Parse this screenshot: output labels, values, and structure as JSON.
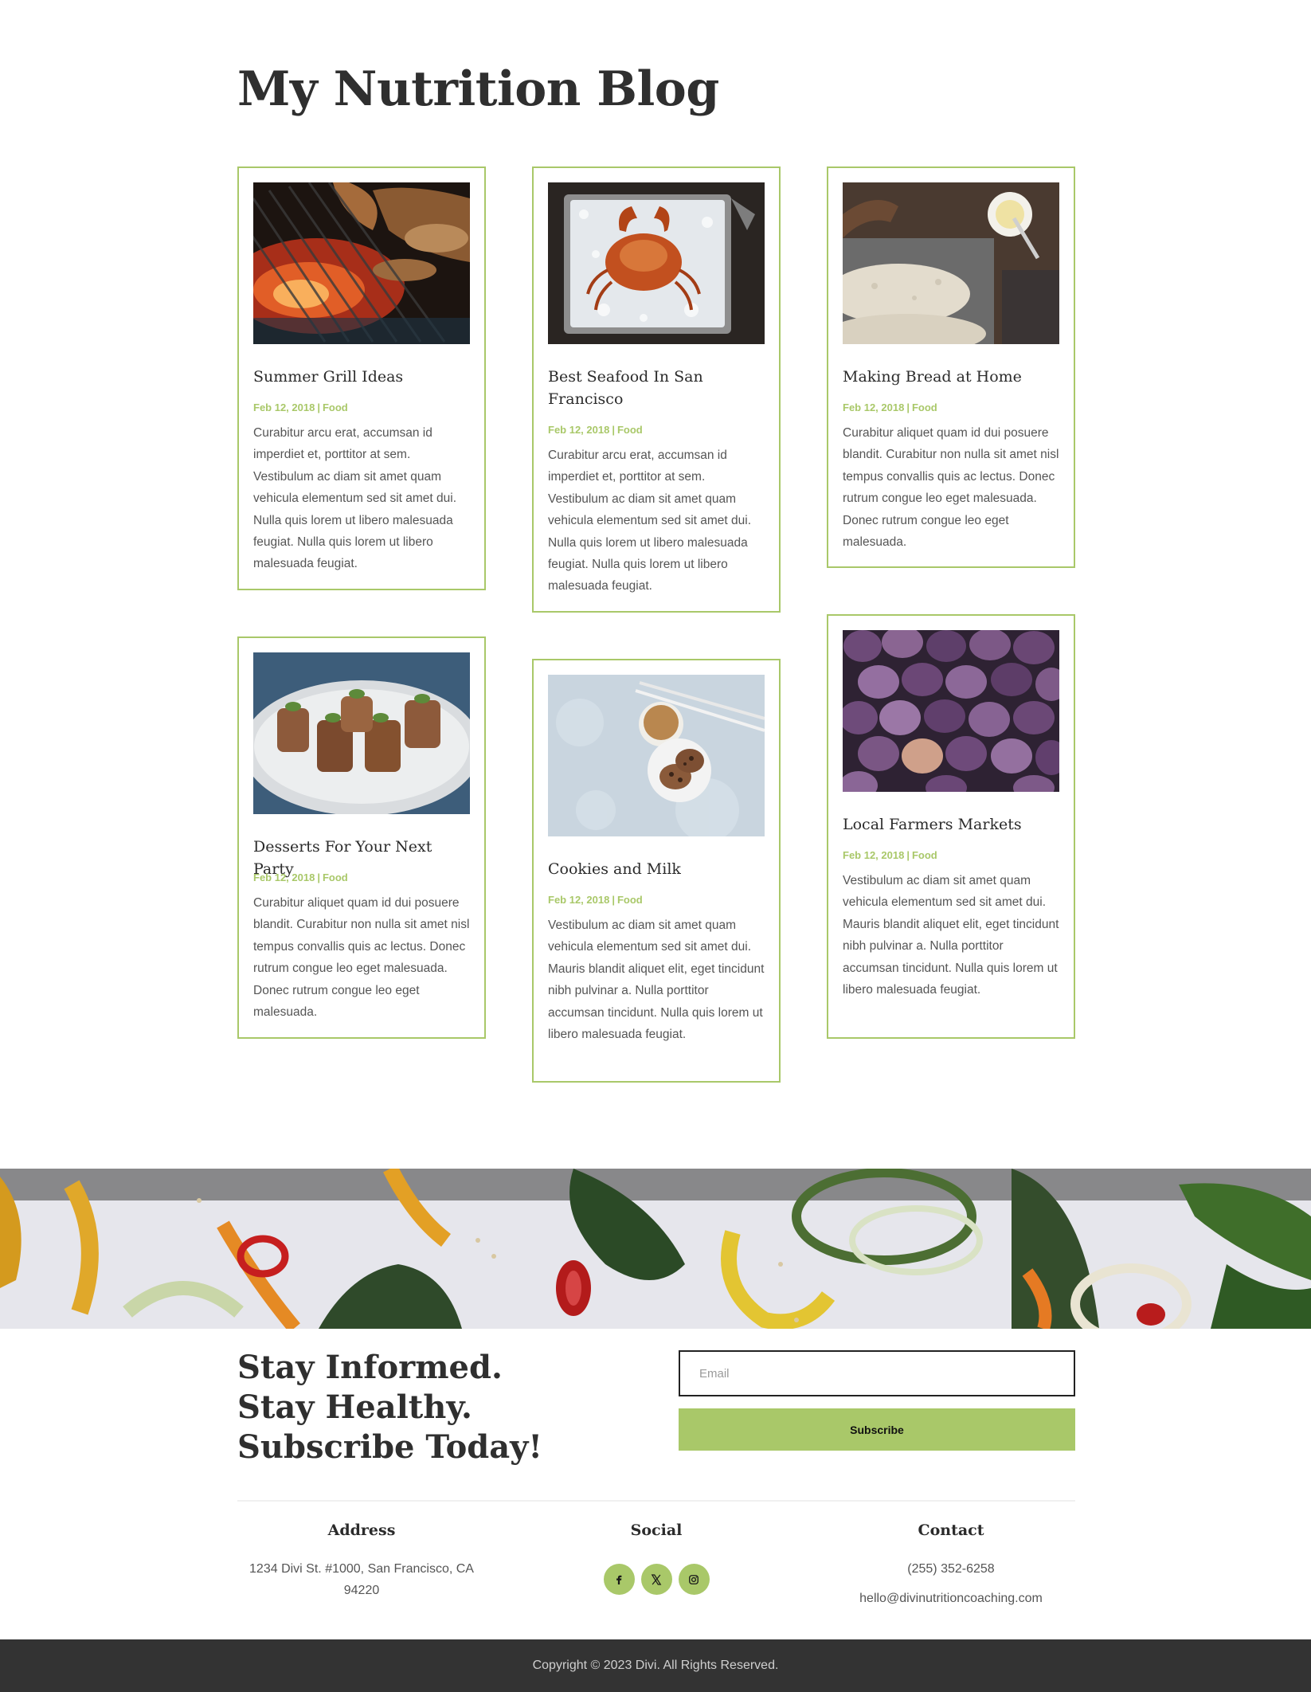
{
  "page": {
    "title": "My Nutrition Blog"
  },
  "posts": [
    {
      "title": "Summer Grill Ideas",
      "date": "Feb 12, 2018",
      "category": "Food",
      "excerpt": "Curabitur arcu erat, accumsan id imperdiet et, porttitor at sem. Vestibulum ac diam sit amet quam vehicula elementum sed sit amet dui. Nulla quis lorem ut libero malesuada feugiat. Nulla quis lorem ut libero malesuada feugiat.",
      "image": "grill-photo"
    },
    {
      "title": "Best Seafood In San Francisco",
      "date": "Feb 12, 2018",
      "category": "Food",
      "excerpt": "Curabitur arcu erat, accumsan id imperdiet et, porttitor at sem. Vestibulum ac diam sit amet quam vehicula elementum sed sit amet dui. Nulla quis lorem ut libero malesuada feugiat. Nulla quis lorem ut libero malesuada feugiat.",
      "image": "crab-photo"
    },
    {
      "title": "Making Bread at Home",
      "date": "Feb 12, 2018",
      "category": "Food",
      "excerpt": "Curabitur aliquet quam id dui posuere blandit. Curabitur non nulla sit amet nisl tempus convallis quis ac lectus. Donec rutrum congue leo eget malesuada. Donec rutrum congue leo eget malesuada.",
      "image": "bread-photo"
    },
    {
      "title": "Desserts For Your Next Party",
      "date": "Feb 12, 2018",
      "category": "Food",
      "excerpt": "Curabitur aliquet quam id dui posuere blandit. Curabitur non nulla sit amet nisl tempus convallis quis ac lectus. Donec rutrum congue leo eget malesuada. Donec rutrum congue leo eget malesuada.",
      "image": "desserts-photo"
    },
    {
      "title": "Cookies and Milk",
      "date": "Feb 12, 2018",
      "category": "Food",
      "excerpt": "Vestibulum ac diam sit amet quam vehicula elementum sed sit amet dui. Mauris blandit aliquet elit, eget tincidunt nibh pulvinar a. Nulla porttitor accumsan tincidunt. Nulla quis lorem ut libero malesuada feugiat.",
      "image": "cookies-photo"
    },
    {
      "title": "Local Farmers Markets",
      "date": "Feb 12, 2018",
      "category": "Food",
      "excerpt": "Vestibulum ac diam sit amet quam vehicula elementum sed sit amet dui. Mauris blandit aliquet elit, eget tincidunt nibh pulvinar a. Nulla porttitor accumsan tincidunt. Nulla quis lorem ut libero malesuada feugiat.",
      "image": "figs-photo"
    }
  ],
  "subscribe": {
    "heading": "Stay Informed. Stay Healthy. Subscribe Today!",
    "email_placeholder": "Email",
    "button_label": "Subscribe"
  },
  "footer": {
    "address": {
      "title": "Address",
      "text": "1234 Divi St. #1000, San Francisco, CA 94220"
    },
    "social": {
      "title": "Social",
      "icons": [
        "facebook-icon",
        "x-icon",
        "instagram-icon"
      ]
    },
    "contact": {
      "title": "Contact",
      "phone": "(255) 352-6258",
      "email": "hello@divinutritioncoaching.com"
    },
    "copyright": "Copyright © 2023 Divi. All Rights Reserved."
  },
  "colors": {
    "accent": "#a9c869",
    "text": "#333333",
    "footer_bg": "#333333"
  }
}
